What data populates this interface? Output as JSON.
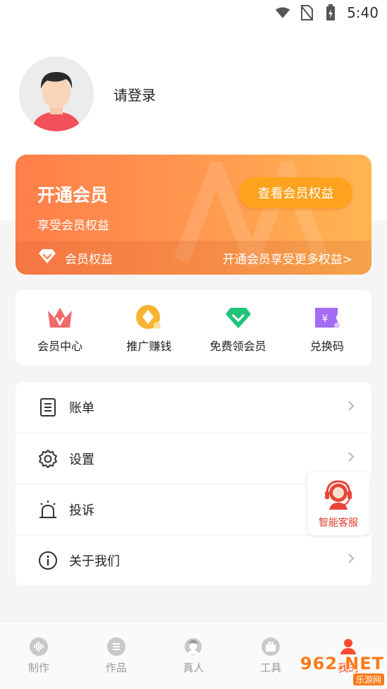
{
  "status_bar": {
    "time": "5:40"
  },
  "profile": {
    "login_text": "请登录"
  },
  "vip_card": {
    "title": "开通会员",
    "subtitle": "享受会员权益",
    "button": "查看会员权益",
    "benefits_label": "会员权益",
    "more_link": "开通会员享受更多权益>"
  },
  "quick_actions": [
    {
      "label": "会员中心",
      "icon": "crown-icon"
    },
    {
      "label": "推广赚钱",
      "icon": "coin-icon"
    },
    {
      "label": "免费领会员",
      "icon": "diamond-icon"
    },
    {
      "label": "兑换码",
      "icon": "ticket-icon"
    }
  ],
  "menu": [
    {
      "label": "账单",
      "icon": "bill-icon"
    },
    {
      "label": "设置",
      "icon": "gear-icon"
    },
    {
      "label": "投诉",
      "icon": "alarm-icon"
    },
    {
      "label": "关于我们",
      "icon": "info-icon"
    }
  ],
  "service": {
    "label": "智能客服"
  },
  "tabs": [
    {
      "label": "制作",
      "icon": "sound-icon"
    },
    {
      "label": "作品",
      "icon": "list-icon"
    },
    {
      "label": "真人",
      "icon": "person-icon"
    },
    {
      "label": "工具",
      "icon": "toolbox-icon"
    },
    {
      "label": "我的",
      "icon": "user-icon",
      "active": true
    }
  ],
  "watermark": {
    "main": "962.NET",
    "sub": "乐游网"
  },
  "colors": {
    "accent": "#ff4a2f",
    "vip_gradient_start": "#ff7e4a",
    "vip_gradient_end": "#ffb651",
    "vip_button": "#ffa21d"
  }
}
